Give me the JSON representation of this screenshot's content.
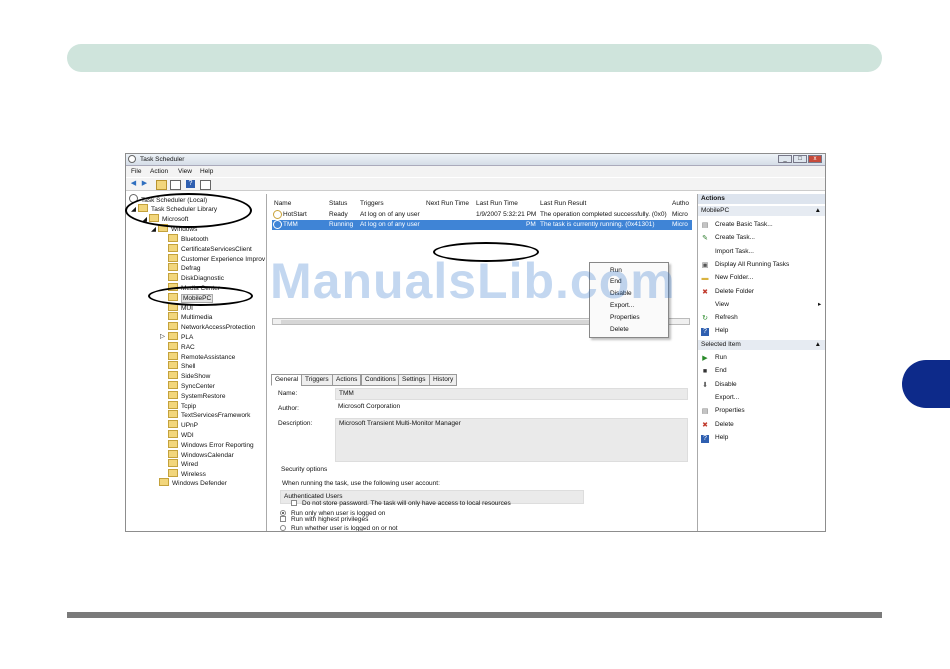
{
  "watermark": "ManualsLib.com",
  "window": {
    "title": "Task Scheduler",
    "controls": [
      "_",
      "□",
      "x"
    ]
  },
  "menu": [
    "File",
    "Action",
    "View",
    "Help"
  ],
  "toolbar_icons": [
    "back-arrow-icon",
    "forward-arrow-icon",
    "folder-icon",
    "console-icon",
    "help-icon",
    "panel-icon"
  ],
  "tree": {
    "root": "Task Scheduler (Local)",
    "library": "Task Scheduler Library",
    "microsoft": "Microsoft",
    "windows": "Windows",
    "children": [
      "Bluetooth",
      "CertificateServicesClient",
      "Customer Experience Improv",
      "Defrag",
      "DiskDiagnostic",
      "Media Center",
      "MobilePC",
      "MUI",
      "Multimedia",
      "NetworkAccessProtection",
      "PLA",
      "RAC",
      "RemoteAssistance",
      "Shell",
      "SideShow",
      "SyncCenter",
      "SystemRestore",
      "Tcpip",
      "TextServicesFramework",
      "UPnP",
      "WDI",
      "Windows Error Reporting",
      "WindowsCalendar",
      "Wired",
      "Wireless"
    ],
    "defender": "Windows Defender"
  },
  "tasklist": {
    "columns": [
      "Name",
      "Status",
      "Triggers",
      "Next Run Time",
      "Last Run Time",
      "Last Run Result",
      "Autho"
    ],
    "rows": [
      {
        "name": "HotStart",
        "status": "Ready",
        "triggers": "At log on of any user",
        "next": "",
        "last": "1/9/2007 5:32:21 PM",
        "result": "The operation completed successfully. (0x0)",
        "author": "Micro"
      },
      {
        "name": "TMM",
        "status": "Running",
        "triggers": "At log on of any user",
        "next": "",
        "last": "PM",
        "result": "The task is currently running. (0x41301)",
        "author": "Micro"
      }
    ]
  },
  "context_menu": [
    "Run",
    "End",
    "Disable",
    "Export...",
    "Properties",
    "Delete"
  ],
  "tabs": [
    "General",
    "Triggers",
    "Actions",
    "Conditions",
    "Settings",
    "History"
  ],
  "general": {
    "name_label": "Name:",
    "name_value": "TMM",
    "author_label": "Author:",
    "author_value": "Microsoft Corporation",
    "description_label": "Description:",
    "description_value": "Microsoft Transient Multi-Monitor Manager",
    "security_label": "Security options",
    "account_prompt": "When running the task, use the following user account:",
    "account_value": "Authenticated Users",
    "opt_logged_on": "Run only when user is logged on",
    "opt_whether": "Run whether user is logged on or not",
    "opt_no_store": "Do not store password.  The task will only have access to local resources",
    "opt_highest": "Run with highest privileges"
  },
  "actions_panel": {
    "header": "Actions",
    "section1": "MobilePC",
    "items1": [
      "Create Basic Task...",
      "Create Task...",
      "Import Task...",
      "Display All Running Tasks",
      "New Folder...",
      "Delete Folder",
      "View",
      "Refresh",
      "Help"
    ],
    "section2": "Selected Item",
    "items2": [
      "Run",
      "End",
      "Disable",
      "Export...",
      "Properties",
      "Delete",
      "Help"
    ]
  },
  "colors": {
    "selection": "#3f84d6",
    "header_bar": "#cfe4dc",
    "side_tab": "#0d2a8a"
  }
}
